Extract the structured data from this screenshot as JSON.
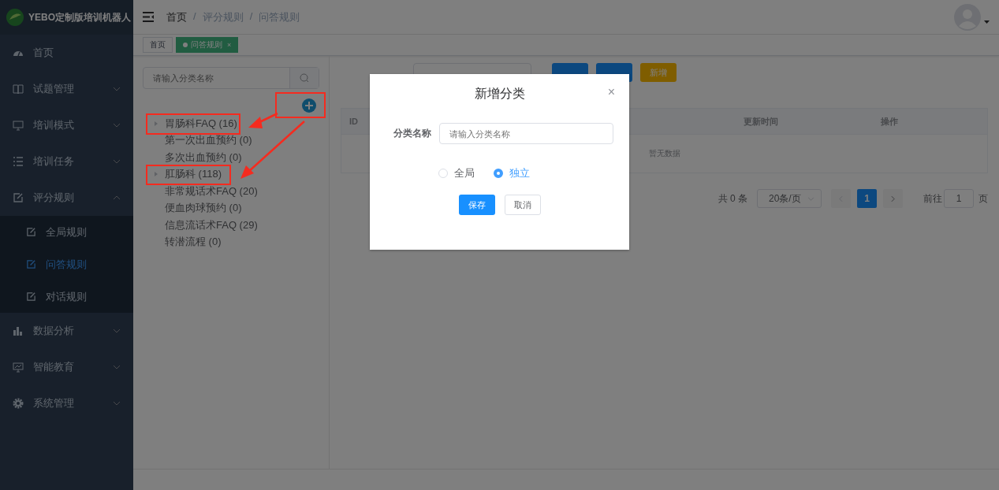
{
  "app": {
    "title": "YEBO定制版培训机器人"
  },
  "sidebar": {
    "items": [
      {
        "label": "首页",
        "kind": "link"
      },
      {
        "label": "试题管理",
        "kind": "group",
        "expanded": false
      },
      {
        "label": "培训模式",
        "kind": "group",
        "expanded": false
      },
      {
        "label": "培训任务",
        "kind": "group",
        "expanded": false
      },
      {
        "label": "评分规则",
        "kind": "group",
        "expanded": true,
        "children": [
          {
            "label": "全局规则",
            "selected": false
          },
          {
            "label": "问答规则",
            "selected": true
          },
          {
            "label": "对话规则",
            "selected": false
          }
        ]
      },
      {
        "label": "数据分析",
        "kind": "group",
        "expanded": false
      },
      {
        "label": "智能教育",
        "kind": "group",
        "expanded": false
      },
      {
        "label": "系统管理",
        "kind": "group",
        "expanded": false
      }
    ]
  },
  "breadcrumb": {
    "separator": "/",
    "items": [
      "首页",
      "评分规则",
      "问答规则"
    ]
  },
  "tabs": [
    {
      "label": "首页",
      "selected": false
    },
    {
      "label": "问答规则",
      "selected": true,
      "close": "×"
    }
  ],
  "tree": {
    "search": {
      "placeholder": "请输入分类名称"
    },
    "add_annotated": true,
    "nodes": [
      {
        "label": "胃肠科FAQ (16)",
        "kind": "branch",
        "expanded": false,
        "annotated": true
      },
      {
        "label": "第一次出血预约 (0)",
        "kind": "leaf",
        "annotated": false
      },
      {
        "label": "多次出血预约 (0)",
        "kind": "leaf",
        "annotated": false
      },
      {
        "label": "肛肠科 (118)",
        "kind": "branch",
        "expanded": false,
        "annotated": true
      },
      {
        "label": "非常规话术FAQ (20)",
        "kind": "leaf",
        "annotated": false
      },
      {
        "label": "便血肉球预约 (0)",
        "kind": "leaf",
        "annotated": false
      },
      {
        "label": "信息流话术FAQ (29)",
        "kind": "leaf",
        "annotated": false
      },
      {
        "label": "转潜流程 (0)",
        "kind": "leaf",
        "annotated": false
      }
    ]
  },
  "filter": {
    "add_button": "新增"
  },
  "table": {
    "columns": [
      "ID",
      "更新时间",
      "操作"
    ],
    "empty": "暂无数据"
  },
  "pagination": {
    "total": "共 0 条",
    "page_size": "20条/页",
    "pages": [
      "1"
    ],
    "goto_label": "前往",
    "goto_value": "1",
    "goto_suffix": "页"
  },
  "dialog": {
    "title": "新增分类",
    "close": "×",
    "field_label": "分类名称",
    "placeholder": "请输入分类名称",
    "options": [
      {
        "label": "全局",
        "selected": false
      },
      {
        "label": "独立",
        "selected": true
      }
    ],
    "buttons": [
      {
        "label": "保存",
        "kind": "primary"
      },
      {
        "label": "取消",
        "kind": "plain"
      }
    ]
  }
}
